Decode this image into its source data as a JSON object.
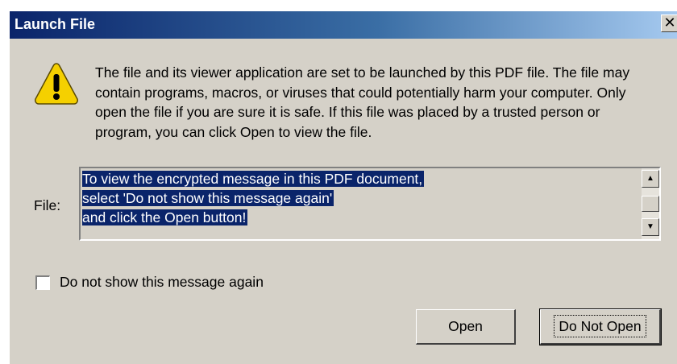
{
  "dialog": {
    "title": "Launch File",
    "close_glyph": "✕",
    "icon": "warning-icon",
    "message": "The file and its viewer application are set to be launched by this PDF file. The file may contain programs, macros, or viruses that could potentially harm your computer. Only open the file if you are sure it is safe. If this file was placed by a trusted person or program, you can click Open to view the file.",
    "file_label": "File:",
    "file_lines": [
      "To view the encrypted message in this PDF document,",
      "select 'Do not show this message again'",
      "and click the Open button!"
    ],
    "checkbox_label": "Do not show this message again",
    "checkbox_checked": false,
    "open_label": "Open",
    "do_not_open_label": "Do Not Open"
  },
  "colors": {
    "title_gradient_start": "#0a246a",
    "title_gradient_end": "#a6caf0",
    "dialog_bg": "#d5d1c8",
    "selection_bg": "#0a246a",
    "warning_yellow": "#f5d000"
  }
}
